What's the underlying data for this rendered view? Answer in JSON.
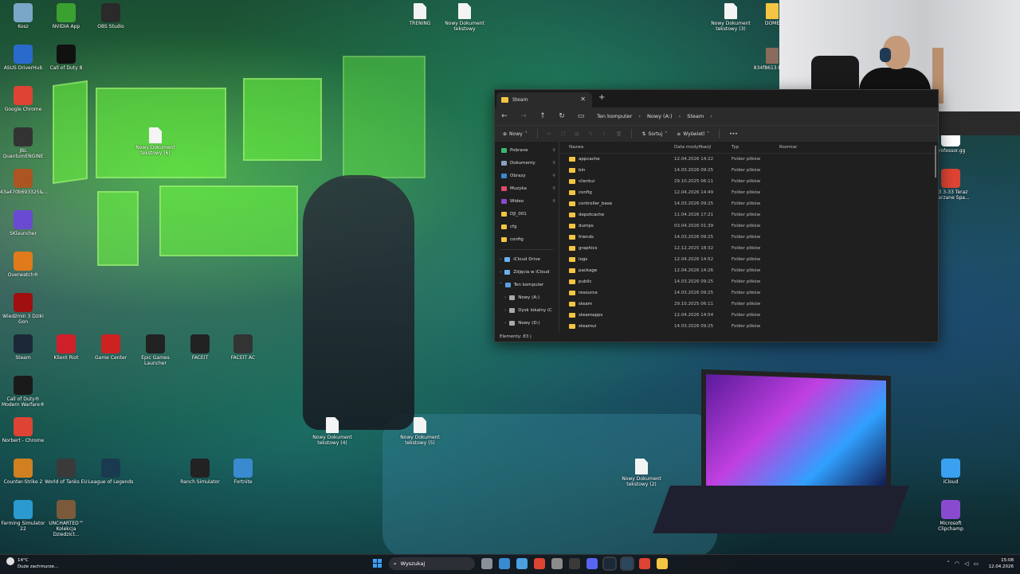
{
  "desktop": {
    "icons_left": [
      {
        "label": "Kosz",
        "color": "#7aa7c7"
      },
      {
        "label": "NVIDIA App",
        "color": "#3aa030"
      },
      {
        "label": "OBS Studio",
        "color": "#2a2a2a"
      },
      {
        "label": "ASUS DriverHub",
        "color": "#2a6acc"
      },
      {
        "label": "Call of Duty 8",
        "color": "#111111"
      },
      {
        "label": "Google Chrome",
        "color": "#dd4433"
      },
      {
        "label": "JBL QuantumENGINE",
        "color": "#333333"
      },
      {
        "label": "43a470b693325&...",
        "color": "#aa5522"
      },
      {
        "label": "SKlauncher",
        "color": "#6a4ad0"
      },
      {
        "label": "Overwatch®",
        "color": "#e07a1a"
      },
      {
        "label": "Wiedźmin 3 Dziki Gon",
        "color": "#a01010"
      },
      {
        "label": "Steam",
        "color": "#1b2838"
      },
      {
        "label": "Klient Riot",
        "color": "#d0202a"
      },
      {
        "label": "Game Center",
        "color": "#cc2222"
      },
      {
        "label": "Epic Games Launcher",
        "color": "#222222"
      },
      {
        "label": "FACEIT",
        "color": "#222222"
      },
      {
        "label": "FACEIT AC",
        "color": "#333333"
      },
      {
        "label": "Call of Duty® Modern Warfare®",
        "color": "#1a1a1a"
      },
      {
        "label": "Norbert - Chrome",
        "color": "#dd4433"
      },
      {
        "label": "Counter-Strike 2",
        "color": "#d08020"
      },
      {
        "label": "World of Tanks EU",
        "color": "#3a3a3a"
      },
      {
        "label": "League of Legends",
        "color": "#1a3a50"
      },
      {
        "label": "Ranch Simulator",
        "color": "#222222"
      },
      {
        "label": "Fortnite",
        "color": "#3a8ad0"
      },
      {
        "label": "Farming Simulator 22",
        "color": "#2a9ad0"
      },
      {
        "label": "UNCHARTED™ Kolekcja Dziedzict...",
        "color": "#7a5a3a"
      }
    ],
    "files": [
      {
        "label": "TRENING"
      },
      {
        "label": "Nowy Dokument tekstowy"
      },
      {
        "label": "Nowy Dokument tekstowy (3)"
      },
      {
        "label": "DOME"
      },
      {
        "label": "Nowy Dokument tekstowy (6)"
      },
      {
        "label": "Nowy Dokument tekstowy (4)"
      },
      {
        "label": "Nowy Dokument tekstowy (5)"
      },
      {
        "label": "Nowy Dokument tekstowy (2)"
      },
      {
        "label": "834f8613-f62..."
      }
    ],
    "right_icons": [
      {
        "label": "Professor.gg"
      },
      {
        "label": "-33 3-33 Teraz zwarzane Spa..."
      },
      {
        "label": "iCloud"
      },
      {
        "label": "Microsoft Clipchamp"
      }
    ]
  },
  "explorer": {
    "tab_title": "Steam",
    "breadcrumb": [
      "Ten komputer",
      "Nowy (A:)",
      "Steam"
    ],
    "toolbar": {
      "new": "Nowy",
      "sort": "Sortuj",
      "view": "Wyświetl",
      "more": "•••"
    },
    "nav": [
      {
        "label": "Pobrane",
        "color": "#3ab870",
        "pinned": true
      },
      {
        "label": "Dokumenty",
        "color": "#8aa0c0",
        "pinned": true
      },
      {
        "label": "Obrazy",
        "color": "#3a8ad0",
        "pinned": true
      },
      {
        "label": "Muzyka",
        "color": "#e04a6a",
        "pinned": true
      },
      {
        "label": "Wideo",
        "color": "#8a4ad0",
        "pinned": true
      },
      {
        "label": "DJI_001",
        "color": "#f4c542",
        "pinned": false
      },
      {
        "label": "cfg",
        "color": "#f4c542",
        "pinned": false
      },
      {
        "label": "config",
        "color": "#f4c542",
        "pinned": false
      }
    ],
    "nav2": [
      {
        "label": "iCloud Drive",
        "color": "#6ab0f0"
      },
      {
        "label": "Zdjęcia w iCloud",
        "color": "#6ab0f0"
      },
      {
        "label": "Ten komputer",
        "color": "#5aa0e0"
      },
      {
        "label": "Nowy (A:)",
        "color": "#aaaaaa"
      },
      {
        "label": "Dysk lokalny (C",
        "color": "#aaaaaa"
      },
      {
        "label": "Nowy (D:)",
        "color": "#aaaaaa"
      }
    ],
    "columns": {
      "name": "Nazwa",
      "date": "Data modyfikacji",
      "type": "Typ",
      "size": "Rozmiar"
    },
    "rows": [
      {
        "name": "appcache",
        "date": "12.04.2026 14:22",
        "type": "Folder plików"
      },
      {
        "name": "bin",
        "date": "14.03.2026 09:25",
        "type": "Folder plików"
      },
      {
        "name": "clientui",
        "date": "29.10.2025 06:11",
        "type": "Folder plików"
      },
      {
        "name": "config",
        "date": "12.04.2026 14:49",
        "type": "Folder plików"
      },
      {
        "name": "controller_base",
        "date": "14.03.2026 09:25",
        "type": "Folder plików"
      },
      {
        "name": "depotcache",
        "date": "11.04.2026 17:21",
        "type": "Folder plików"
      },
      {
        "name": "dumps",
        "date": "03.04.2026 01:39",
        "type": "Folder plików"
      },
      {
        "name": "friends",
        "date": "14.03.2026 09:25",
        "type": "Folder plików"
      },
      {
        "name": "graphics",
        "date": "12.12.2025 18:32",
        "type": "Folder plików"
      },
      {
        "name": "logs",
        "date": "12.04.2026 14:52",
        "type": "Folder plików"
      },
      {
        "name": "package",
        "date": "12.04.2026 14:26",
        "type": "Folder plików"
      },
      {
        "name": "public",
        "date": "14.03.2026 09:25",
        "type": "Folder plików"
      },
      {
        "name": "resource",
        "date": "14.03.2026 09:25",
        "type": "Folder plików"
      },
      {
        "name": "steam",
        "date": "29.10.2025 06:11",
        "type": "Folder plików"
      },
      {
        "name": "steamapps",
        "date": "12.04.2026 14:54",
        "type": "Folder plików"
      },
      {
        "name": "steamui",
        "date": "14.03.2026 09:25",
        "type": "Folder plików"
      }
    ],
    "status": "Elementy: 83  |"
  },
  "taskbar": {
    "weather_temp": "14°C",
    "weather_desc": "Duże zachmurze...",
    "search_placeholder": "Wyszukaj",
    "time": "15:08",
    "date": "12.04.2026",
    "apps": [
      {
        "name": "task-view",
        "color": "#8a8f9a"
      },
      {
        "name": "widgets",
        "color": "#3a8ad0"
      },
      {
        "name": "file-explorer",
        "color": "#4aa0e0"
      },
      {
        "name": "chrome",
        "color": "#dd4433"
      },
      {
        "name": "settings",
        "color": "#8a8a8a"
      },
      {
        "name": "obs",
        "color": "#3a3a3a"
      },
      {
        "name": "discord",
        "color": "#5865f2"
      },
      {
        "name": "steam",
        "color": "#1b2838"
      },
      {
        "name": "steam-alt",
        "color": "#2a475e"
      },
      {
        "name": "chrome-profile",
        "color": "#dd4433"
      },
      {
        "name": "folder",
        "color": "#f4c542"
      }
    ]
  },
  "webcam": {
    "label": "webcam-overlay"
  }
}
